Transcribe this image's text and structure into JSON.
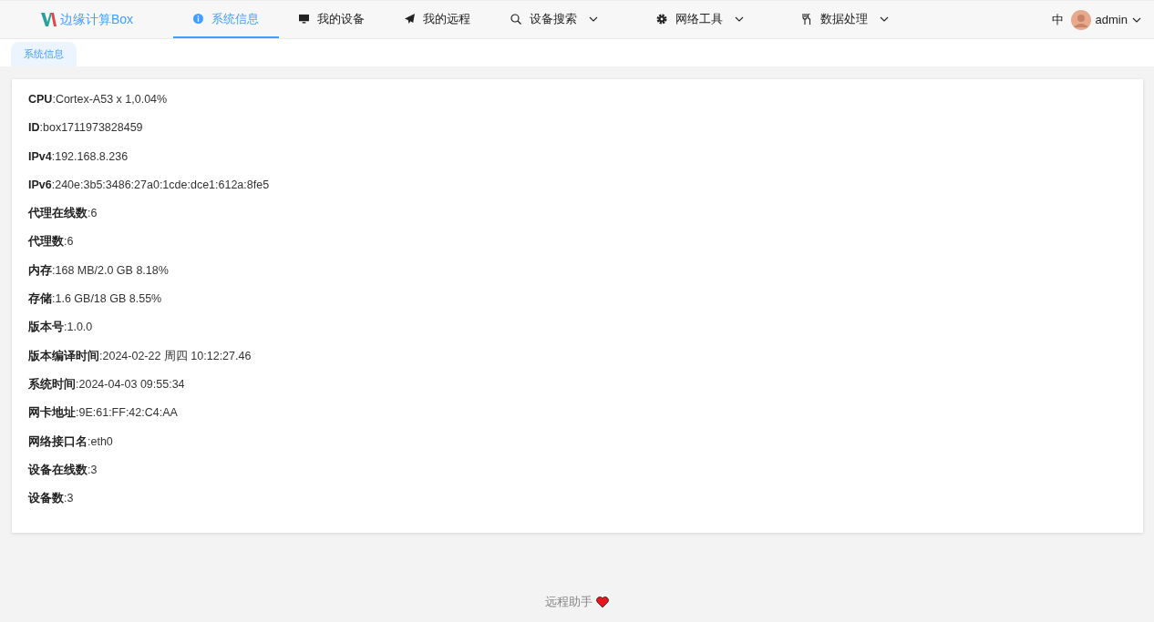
{
  "header": {
    "logo": "边缘计算Box",
    "nav": [
      {
        "label": "系统信息",
        "kind": "info",
        "selected": true,
        "dropdown": false
      },
      {
        "label": "我的设备",
        "kind": "monitor",
        "selected": false,
        "dropdown": false
      },
      {
        "label": "我的远程",
        "kind": "plane",
        "selected": false,
        "dropdown": false
      },
      {
        "label": "设备搜索",
        "kind": "search",
        "selected": false,
        "dropdown": true
      },
      {
        "label": "网络工具",
        "kind": "gear",
        "selected": false,
        "dropdown": true
      },
      {
        "label": "数据处理",
        "kind": "utensils",
        "selected": false,
        "dropdown": true
      }
    ],
    "language": "中",
    "user": "admin"
  },
  "tabs": [
    {
      "label": "系统信息",
      "selected": true
    }
  ],
  "info": [
    "**CPU**:Cortex-A53 x 1,0.04%",
    "**ID**:box1711973828459",
    "**IPv4**:192.168.8.236",
    "**IPv6**:240e:3b5:3486:27a0:1cde:dce1:612a:8fe5",
    "**代理在线数**:6",
    "**代理数**:6",
    "**内存**:168 MB/2.0 GB 8.18%",
    "**存储**:1.6 GB/18 GB 8.55%",
    "**版本号**:1.0.0",
    "**版本编译时间**:2024-02-22 周四 10:12:27.46",
    "**系统时间**:2024-04-03 09:55:34",
    "**网卡地址**:9E:61:FF:42:C4:AA",
    "**网络接口名**:eth0",
    "**设备在线数**:3",
    "**设备数**:3"
  ],
  "footer": "远程助手"
}
